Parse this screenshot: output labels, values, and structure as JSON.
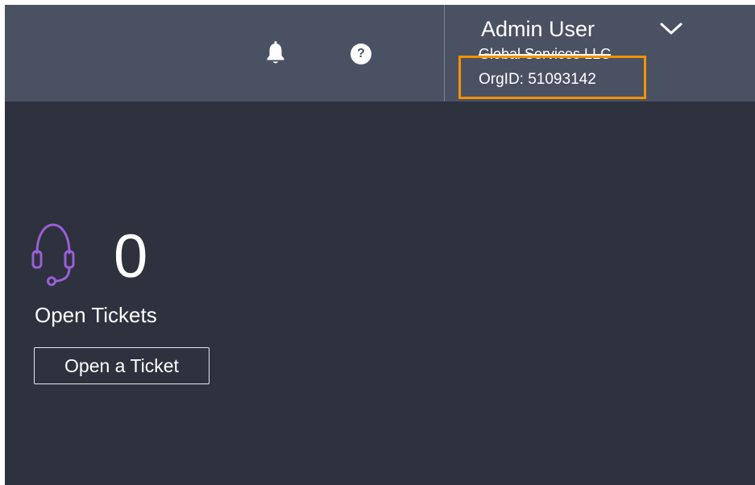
{
  "header": {
    "notifications_icon": "bell-icon",
    "help_icon": "help-icon",
    "help_glyph": "?",
    "user": {
      "name": "Admin User",
      "organization": "Global Services LLC",
      "org_id": "OrgID: 51093142",
      "menu_icon": "chevron-down-icon"
    }
  },
  "main": {
    "tickets": {
      "icon": "headset-icon",
      "count": "0",
      "label": "Open Tickets",
      "button_label": "Open a Ticket"
    }
  },
  "colors": {
    "topbar": "#4a5163",
    "background": "#2d323e",
    "highlight": "#f39200",
    "headset_accent": "#9b5fd6"
  }
}
